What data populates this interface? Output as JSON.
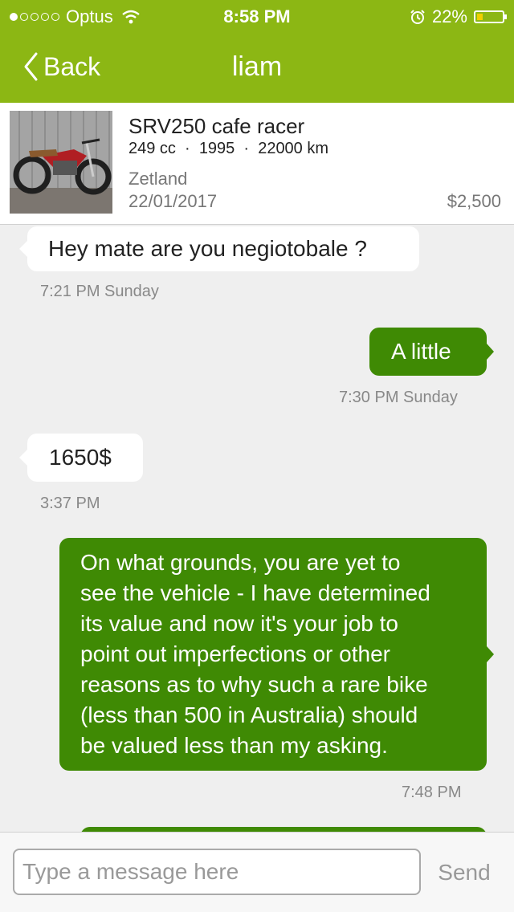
{
  "status_bar": {
    "carrier": "Optus",
    "time": "8:58 PM",
    "battery": "22%"
  },
  "nav": {
    "back_label": "Back",
    "title": "liam"
  },
  "listing": {
    "title": "SRV250 cafe racer",
    "specs": "249 cc  ·  1995  ·  22000 km",
    "location": "Zetland",
    "date": "22/01/2017",
    "price": "$2,500"
  },
  "messages": [
    {
      "direction": "in",
      "text": "Hey mate are you negiotobale ?",
      "time": "7:21 PM Sunday"
    },
    {
      "direction": "out",
      "text": "A little",
      "time": "7:30 PM Sunday"
    },
    {
      "direction": "in",
      "text": "1650$",
      "time": "3:37 PM"
    },
    {
      "direction": "out",
      "lines": [
        "On what grounds, you are yet to",
        "see the vehicle - I have determined",
        "its value and now it's your job to",
        "point out imperfections or other",
        "reasons as to why such a rare bike",
        "(less than 500 in Australia) should",
        "be valued less than my asking."
      ],
      "time": "7:48 PM"
    }
  ],
  "composer": {
    "placeholder": "Type a message here",
    "send_label": "Send"
  },
  "colors": {
    "header": "#8cb714",
    "outgoing_bubble": "#3f8a04",
    "incoming_bubble": "#ffffff",
    "background": "#efefef"
  },
  "icons": {
    "back": "chevron-left-icon",
    "wifi": "wifi-icon",
    "alarm": "alarm-icon",
    "battery": "battery-icon"
  }
}
